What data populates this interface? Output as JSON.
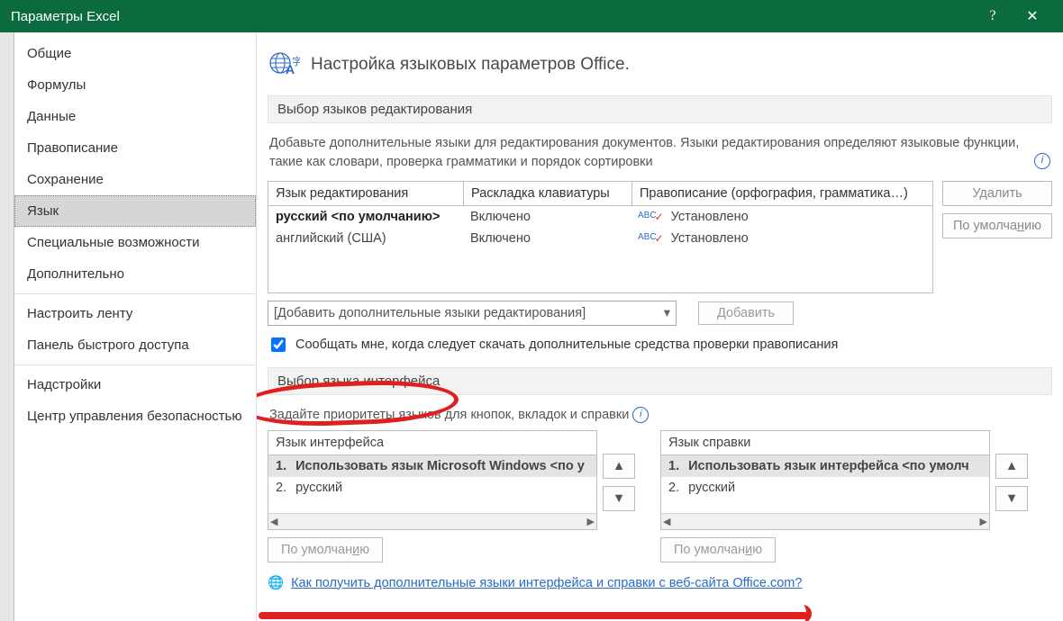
{
  "window": {
    "title": "Параметры Excel"
  },
  "sidebar": {
    "items": [
      "Общие",
      "Формулы",
      "Данные",
      "Правописание",
      "Сохранение",
      "Язык",
      "Специальные возможности",
      "Дополнительно",
      "Настроить ленту",
      "Панель быстрого доступа",
      "Надстройки",
      "Центр управления безопасностью"
    ],
    "selected": 5
  },
  "header": {
    "title": "Настройка языковых параметров Office."
  },
  "editing": {
    "section": "Выбор языков редактирования",
    "description": "Добавьте дополнительные языки для редактирования документов. Языки редактирования определяют языковые функции, такие как словари, проверка грамматики и порядок сортировки",
    "columns": [
      "Язык редактирования",
      "Раскладка клавиатуры",
      "Правописание (орфография, грамматика…)"
    ],
    "rows": [
      {
        "lang": "русский <по умолчанию>",
        "layout": "Включено",
        "spell": "Установлено",
        "bold": true
      },
      {
        "lang": "английский (США)",
        "layout": "Включено",
        "spell": "Установлено",
        "bold": false
      }
    ],
    "buttons": {
      "remove": "Удалить",
      "default_pre": "По умолча",
      "default_u": "н",
      "default_post": "ию"
    },
    "combo": "[Добавить дополнительные языки редактирования]",
    "add_pre": "Д",
    "add_post": "обавить",
    "checkbox": "Сообщать мне, когда следует скачать дополнительные средства проверки правописания"
  },
  "display": {
    "section": "Выбор языка интерфейса",
    "description": "Задайте приоритеты языков для кнопок, вкладок и справки",
    "ui": {
      "label": "Язык интерфейса",
      "items": [
        {
          "n": "1.",
          "text": "Использовать язык Microsoft Windows <по у"
        },
        {
          "n": "2.",
          "text": "русский"
        }
      ]
    },
    "help": {
      "label": "Язык справки",
      "items": [
        {
          "n": "1.",
          "text": "Использовать язык интерфейса <по умолч"
        },
        {
          "n": "2.",
          "text": "русский"
        }
      ]
    },
    "default_pre": "По умолчан",
    "default_u": "и",
    "default_post": "ю",
    "link": "Как получить дополнительные языки интерфейса и справки с веб-сайта Office.com?"
  }
}
